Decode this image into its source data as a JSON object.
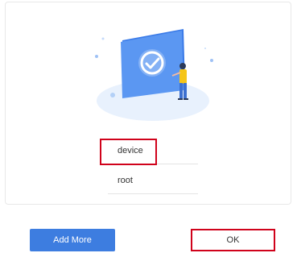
{
  "form": {
    "device_value": "device",
    "user_value": "root"
  },
  "buttons": {
    "add_more_label": "Add More",
    "ok_label": "OK"
  },
  "colors": {
    "primary": "#3d7de0",
    "highlight": "#d0021b",
    "illustration_blue": "#4a8cf0",
    "illustration_bg": "#e8f1fd"
  },
  "icons": {
    "illustration": "person-with-checkmark-board-illustration"
  }
}
